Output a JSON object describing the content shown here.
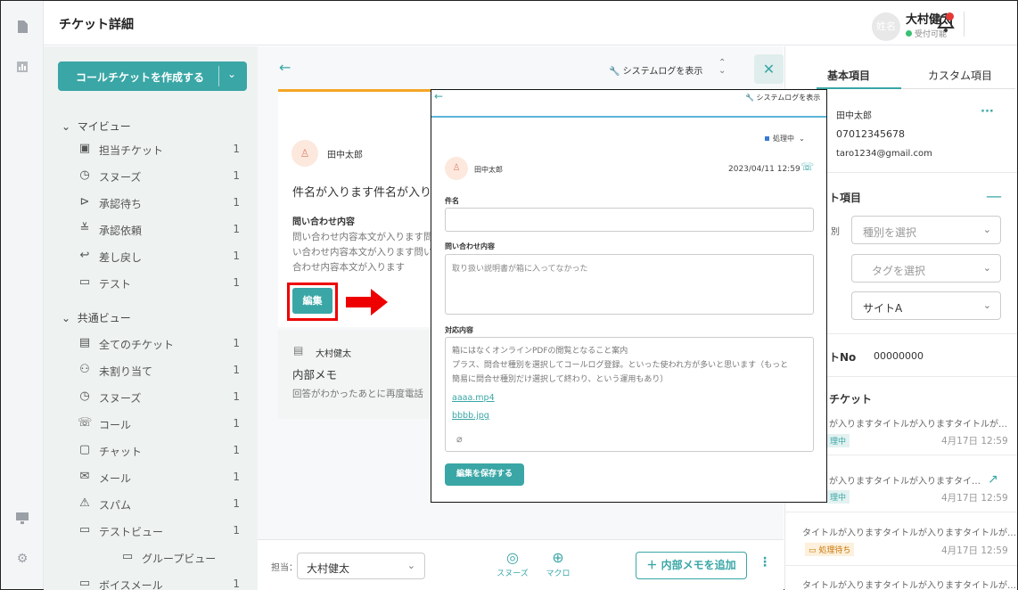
{
  "header": {
    "title": "チケット詳細",
    "avatar_text": "姓名",
    "user_name": "大村健太",
    "user_status": "受付可能"
  },
  "sidebar": {
    "create_button": "コールチケットを作成する",
    "sections": [
      {
        "label": "マイビュー",
        "items": [
          {
            "label": "担当チケット",
            "count": "1",
            "icon": "assigned-ticket-icon"
          },
          {
            "label": "スヌーズ",
            "count": "1",
            "icon": "clock-icon"
          },
          {
            "label": "承認待ち",
            "count": "1",
            "icon": "approval-wait-icon"
          },
          {
            "label": "承認依頼",
            "count": "1",
            "icon": "approval-request-icon"
          },
          {
            "label": "差し戻し",
            "count": "1",
            "icon": "return-icon"
          },
          {
            "label": "テスト",
            "count": "1",
            "icon": "folder-icon"
          }
        ]
      },
      {
        "label": "共通ビュー",
        "items": [
          {
            "label": "全てのチケット",
            "count": "1",
            "icon": "inbox-icon"
          },
          {
            "label": "未割り当て",
            "count": "1",
            "icon": "add-user-icon"
          },
          {
            "label": "スヌーズ",
            "count": "1",
            "icon": "clock-icon"
          },
          {
            "label": "コール",
            "count": "1",
            "icon": "phone-icon"
          },
          {
            "label": "チャット",
            "count": "1",
            "icon": "chat-icon"
          },
          {
            "label": "メール",
            "count": "1",
            "icon": "mail-icon"
          },
          {
            "label": "スパム",
            "count": "1",
            "icon": "warning-icon"
          },
          {
            "label": "テストビュー",
            "count": "1",
            "icon": "folder-icon"
          },
          {
            "label": "グループビュー",
            "count": "",
            "icon": "folder-icon"
          },
          {
            "label": "ボイスメール",
            "count": "1",
            "icon": "folder-icon"
          }
        ]
      }
    ]
  },
  "center": {
    "syslog_label": "システムログを表示",
    "author": "田中太郎",
    "subject": "件名が入ります件名が入り",
    "inquiry_label": "問い合わせ内容",
    "inquiry_body": "問い合わせ内容本文が入ります問い合わせ内容本文が入ります問い合わせ内容本文が入ります",
    "edit_button": "編集",
    "memo_author": "大村健太",
    "memo_title": "内部メモ",
    "memo_body": "回答がわかったあとに再度電話"
  },
  "bottom_bar": {
    "assignee_label": "担当：",
    "assignee_value": "大村健太",
    "snooze": "スヌーズ",
    "macro": "マクロ",
    "add_memo": "＋ 内部メモを追加"
  },
  "right_panel": {
    "tabs": [
      "基本項目",
      "カスタム項目"
    ],
    "name": "田中太郎",
    "phone": "07012345678",
    "email": "taro1234@gmail.com",
    "section_items": "ト項目",
    "kind_label": "別",
    "kind_select": "種別を選択",
    "tag_select": "タグを選択",
    "site_select": "サイトA",
    "ticket_no_label": "トNo",
    "ticket_no_value": "00000000",
    "related_label": "チケット",
    "related": [
      {
        "title": "が入りますタイトルが入りますタイトルが…",
        "status": "理中",
        "date": "4月17日 12:59"
      },
      {
        "title": "が入りますタイトルが入りますタイ…",
        "status": "理中",
        "date": "4月17日 12:59"
      },
      {
        "title": "タイトルが入りますタイトルが入りますタイトルが…",
        "status": "処理待ち",
        "date": "4月17日 12:59"
      },
      {
        "title": "タイトルが入りますタイトルが入りますタイトルが…",
        "status": "",
        "date": ""
      }
    ]
  },
  "modal": {
    "syslog_label": "システムログを表示",
    "status": "処理中",
    "author": "田中太郎",
    "date": "2023/04/11 12:59",
    "subject_label": "件名",
    "inquiry_label": "問い合わせ内容",
    "inquiry_value": "取り扱い説明書が箱に入ってなかった",
    "response_label": "対応内容",
    "response_lines": [
      "箱にはなくオンラインPDFの閲覧となること案内",
      "プラス、問合せ種別を選択してコールログ登録。といった使われ方が多いと思います（もっと",
      "簡易に問合せ種別だけ選択して終わり、という運用もあり）"
    ],
    "attachments": [
      "aaaa.mp4",
      "bbbb.jpg"
    ],
    "save_button": "編集を保存する"
  },
  "colors": {
    "accent": "#3aa6a6",
    "highlight": "#e00000",
    "orange": "#f5a623"
  }
}
